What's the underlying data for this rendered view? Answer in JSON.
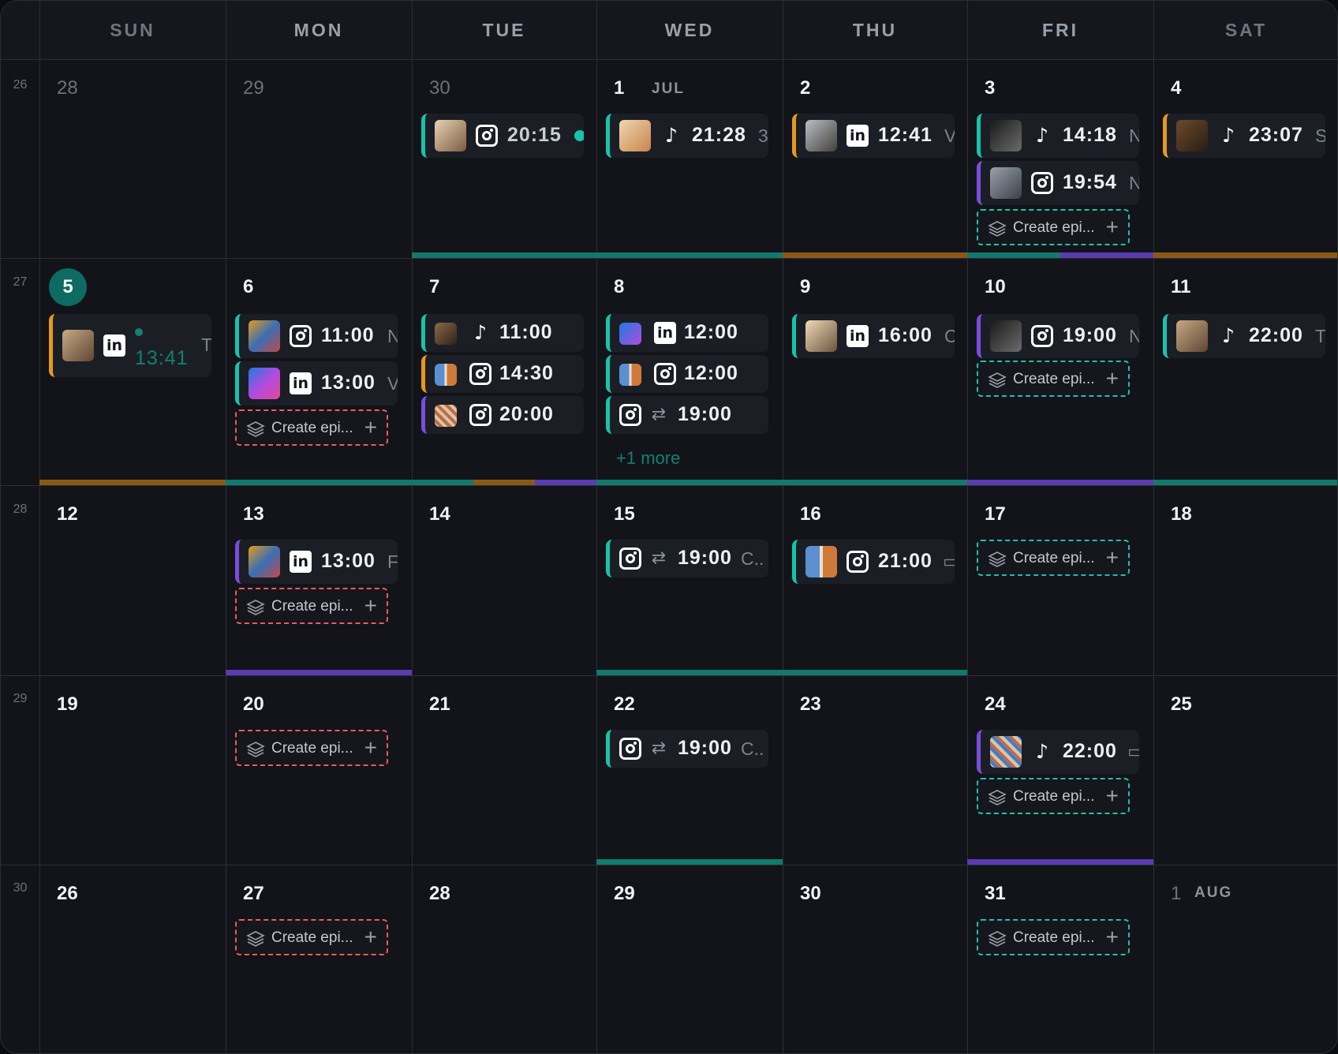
{
  "weekdays": [
    "SUN",
    "MON",
    "TUE",
    "WED",
    "THU",
    "FRI",
    "SAT"
  ],
  "week_numbers": [
    "26",
    "27",
    "28",
    "29",
    "30"
  ],
  "days": {
    "w0": [
      "28",
      "29",
      "30",
      "1",
      "2",
      "3",
      "4"
    ],
    "w1": [
      "5",
      "6",
      "7",
      "8",
      "9",
      "10",
      "11"
    ],
    "w2": [
      "12",
      "13",
      "14",
      "15",
      "16",
      "17",
      "18"
    ],
    "w3": [
      "19",
      "20",
      "21",
      "22",
      "23",
      "24",
      "25"
    ],
    "w4": [
      "26",
      "27",
      "28",
      "29",
      "30",
      "31",
      "1"
    ]
  },
  "month_labels": {
    "jul": "JUL",
    "aug": "AUG"
  },
  "create_label": "Create epi...",
  "plus": "+",
  "more_label": "+1 more",
  "trails": {
    "m": "N",
    "three": "3",
    "v": "V",
    "s": "S",
    "t": "T",
    "c": "C",
    "f": "F",
    "cdot": "C..",
    "cam": "▭"
  },
  "times": {
    "e1": "20:15",
    "e2": "21:28",
    "e3": "12:41",
    "e4": "14:18",
    "e5": "19:54",
    "e6": "23:07",
    "e7": "13:41",
    "e8": "11:00",
    "e9": "13:00",
    "e10": "11:00",
    "e11": "14:30",
    "e12": "20:00",
    "e13": "12:00",
    "e14": "12:00",
    "e15": "19:00",
    "e16": "16:00",
    "e17": "19:00",
    "e18": "22:00",
    "e19": "13:00",
    "e20": "19:00",
    "e21": "21:00",
    "e22": "19:00",
    "e23": "22:00"
  },
  "platform_icons": {
    "instagram": "instagram-icon",
    "tiktok": "tiktok-icon",
    "linkedin": "linkedin-icon",
    "repeat": "repeat-icon"
  },
  "colors": {
    "teal": "#19c2aa",
    "orange": "#e59a1c",
    "purple": "#7a4ce0",
    "red": "#ef5a5a",
    "today": "#0d6b61"
  }
}
